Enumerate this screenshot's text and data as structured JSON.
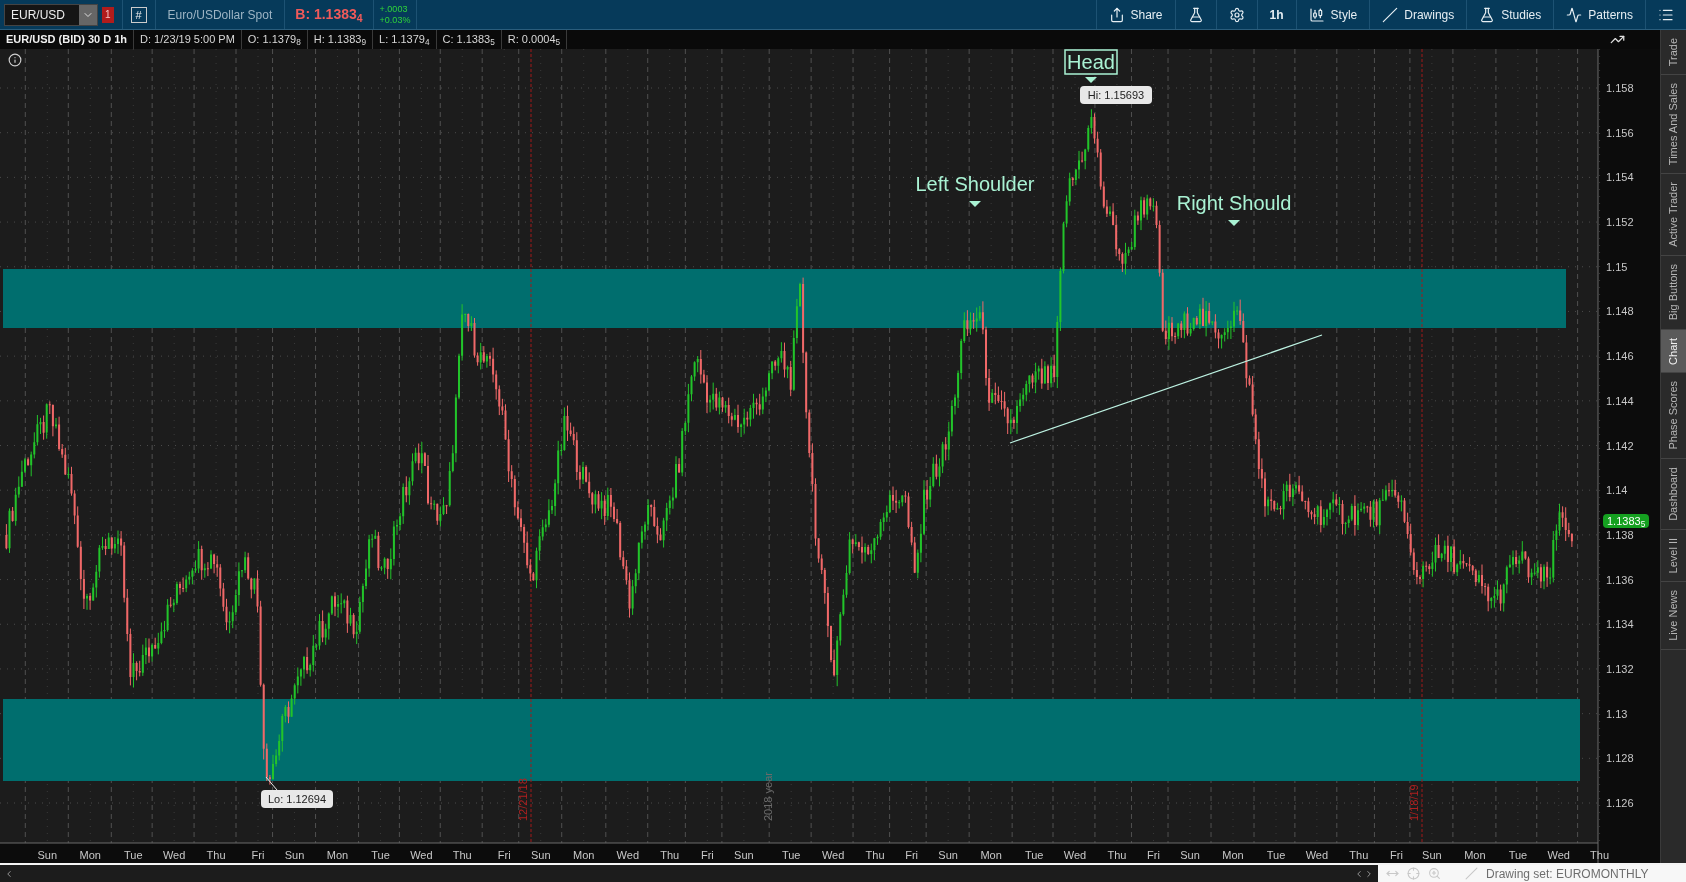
{
  "toolbar": {
    "symbol": "EUR/USD",
    "link_badge": "1",
    "grid_button": "#",
    "description": "Euro/USDollar Spot",
    "bid": "B: 1.1383$_{4}$",
    "change": "+.0003",
    "change_percent": "+0.03%",
    "buttons": [
      {
        "kind": "share",
        "label": "Share"
      },
      {
        "kind": "lab"
      },
      {
        "kind": "settings"
      },
      {
        "kind": "interval",
        "label": "1h"
      },
      {
        "kind": "style",
        "label": "Style"
      },
      {
        "kind": "drawings",
        "label": "Drawings"
      },
      {
        "kind": "studies",
        "label": "Studies"
      },
      {
        "kind": "patterns",
        "label": "Patterns"
      },
      {
        "kind": "menu"
      }
    ]
  },
  "info_bar": [
    "EUR/USD (BID) 30 D 1h",
    "D: 1/23/19 5:00 PM",
    "O: 1.1379$_{8}$",
    "H: 1.1383$_{9}$",
    "L: 1.1379$_{4}$",
    "C: 1.1383$_{5}$",
    "R: 0.0004$_{5}$"
  ],
  "chart": {
    "y_axis": [
      "1.158",
      "1.156",
      "1.154",
      "1.152",
      "1.15",
      "1.148",
      "1.146",
      "1.144",
      "1.142",
      "1.14",
      "1.138",
      "1.136",
      "1.134",
      "1.132",
      "1.13",
      "1.128",
      "1.126"
    ],
    "x_axis": [
      "Sun",
      "Mon",
      "Tue",
      "Wed",
      "Thu",
      "Fri",
      "Sun",
      "Mon",
      "Tue",
      "Wed",
      "Thu",
      "Fri",
      "Sun",
      "Mon",
      "Wed",
      "Thu",
      "Fri",
      "Sun",
      "Tue",
      "Wed",
      "Thu",
      "Fri",
      "Sun",
      "Mon",
      "Tue",
      "Wed",
      "Thu",
      "Fri",
      "Sun",
      "Mon",
      "Tue",
      "Wed",
      "Thu",
      "Fri",
      "Sun",
      "Mon",
      "Tue",
      "Wed",
      "Thu"
    ],
    "last_price": "1.1383$_{5}$",
    "annotations": [
      {
        "kind": "boxed",
        "text": "Head"
      },
      {
        "kind": "plain",
        "text": "Left Shoulder"
      },
      {
        "kind": "plain",
        "text": "Right Should"
      }
    ],
    "callouts": [
      "Hi: 1.15693",
      "Lo: 1.12694"
    ],
    "date_markers": [
      {
        "kind": "period",
        "text": "12/21/18"
      },
      {
        "kind": "year",
        "text": "2018 year"
      },
      {
        "kind": "period",
        "text": "1/18/19"
      }
    ]
  },
  "side_tabs": [
    {
      "label": "Trade",
      "selected": false
    },
    {
      "label": "Times And Sales",
      "selected": false
    },
    {
      "label": "Active Trader",
      "selected": false
    },
    {
      "label": "Big Buttons",
      "selected": false
    },
    {
      "label": "Chart",
      "selected": true
    },
    {
      "label": "Phase Scores",
      "selected": false
    },
    {
      "label": "Dashboard",
      "selected": false
    },
    {
      "label": "Level II",
      "selected": false
    },
    {
      "label": "Live News",
      "selected": false
    }
  ],
  "status_bar": {
    "drawing_set": "Drawing set: EUROMONTHLY"
  }
}
